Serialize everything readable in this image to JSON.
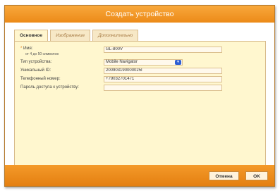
{
  "dialog": {
    "title": "Создать устройство"
  },
  "tabs": [
    {
      "label": "Основное",
      "active": true
    },
    {
      "label": "Изображение",
      "active": false
    },
    {
      "label": "Дополнительно",
      "active": false
    }
  ],
  "form": {
    "name": {
      "label": "Имя:",
      "hint": "от 4 до 50 символов",
      "value": "GL-800V"
    },
    "device_type": {
      "label": "Тип устройства:",
      "value": "Mobile Navigator"
    },
    "unique_id": {
      "label": "Уникальный ID:",
      "value": "200903190000025I"
    },
    "phone": {
      "label": "Телефонный номер:",
      "value": "+79032701471"
    },
    "password": {
      "label": "Пароль доступа к устройству:",
      "value": ""
    }
  },
  "buttons": {
    "cancel": "Отмена",
    "ok": "OK"
  },
  "colors": {
    "accent": "#ec8a18",
    "panel": "#fff7cf"
  }
}
